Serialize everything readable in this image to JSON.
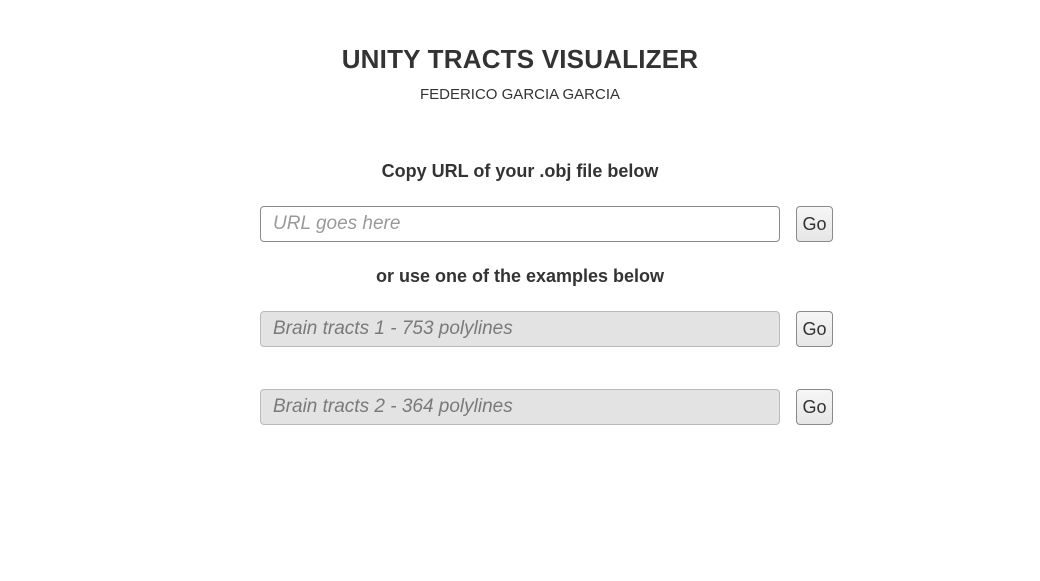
{
  "header": {
    "title": "UNITY TRACTS VISUALIZER",
    "author": "FEDERICO GARCIA GARCIA"
  },
  "url_section": {
    "label": "Copy URL of your .obj file below",
    "input_placeholder": "URL goes here",
    "input_value": "",
    "go_label": "Go"
  },
  "examples_section": {
    "label": "or use one of the examples below",
    "examples": [
      {
        "text": "Brain tracts 1 - 753 polylines",
        "go_label": "Go"
      },
      {
        "text": "Brain tracts 2 - 364 polylines",
        "go_label": "Go"
      }
    ]
  },
  "colors": {
    "text": "#333333",
    "example_field_bg": "#e3e3e3",
    "placeholder": "#9a9a9a"
  }
}
